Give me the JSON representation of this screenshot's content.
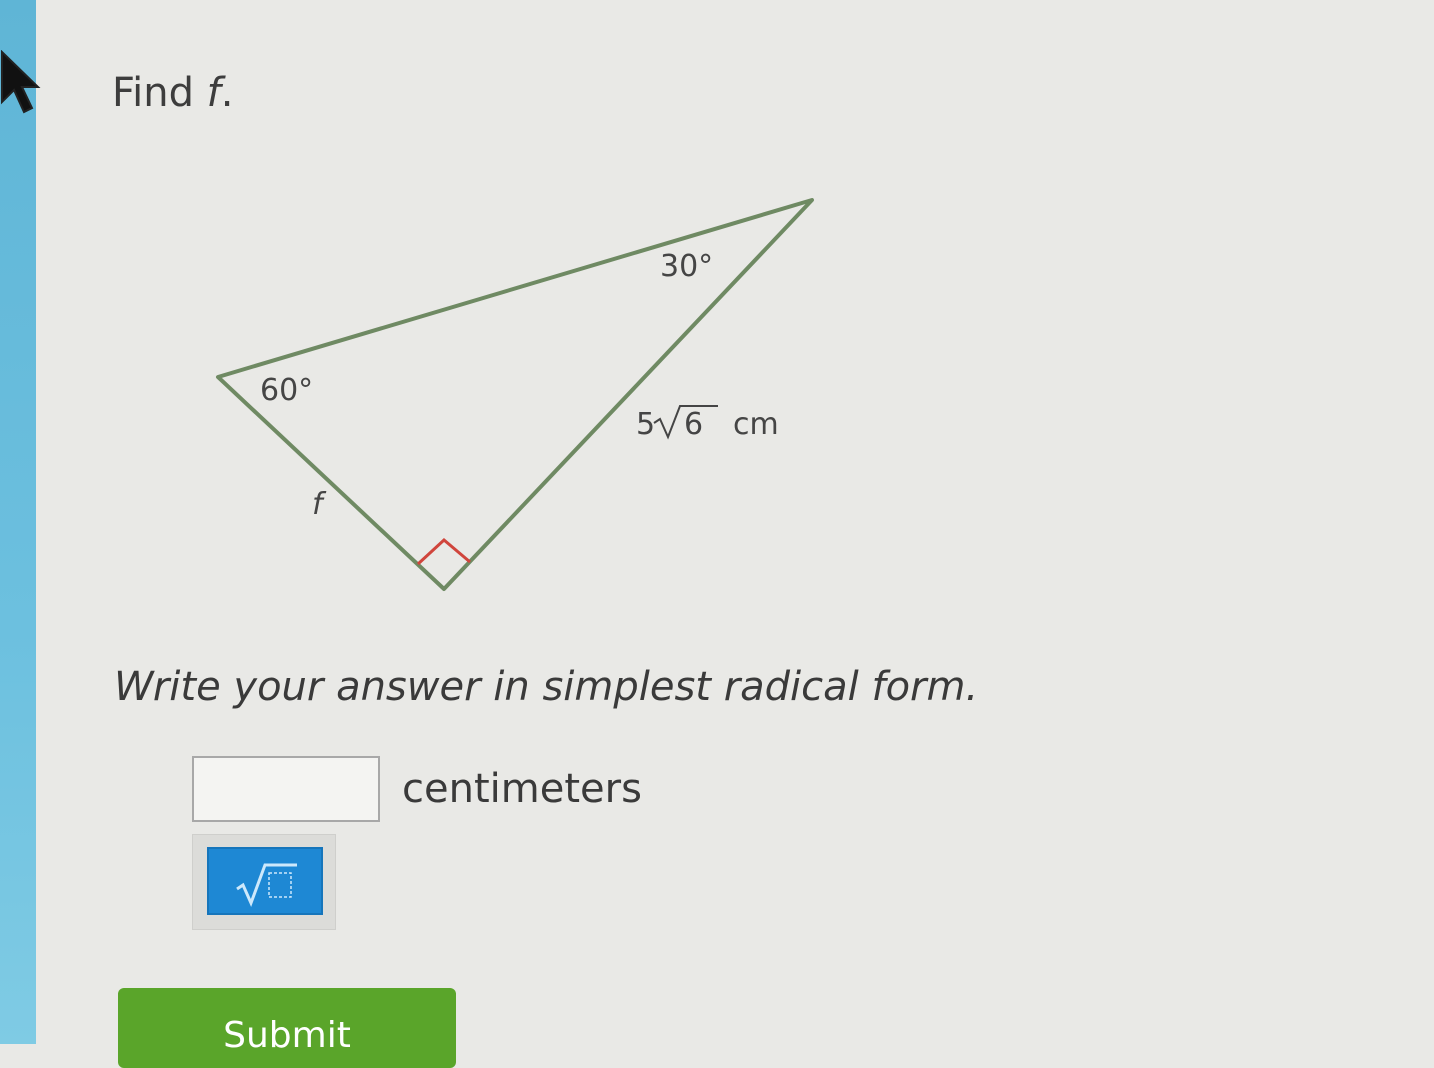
{
  "question": {
    "prefix": "Find ",
    "variable": "f",
    "suffix": "."
  },
  "figure": {
    "angle_top": "30°",
    "angle_left": "60°",
    "side_coefficient": "5",
    "side_radicand": "6",
    "side_unit": "cm",
    "side_variable": "f",
    "right_angle_color": "#d0453c",
    "line_color": "#6f8a63"
  },
  "instructions": "Write your answer in simplest radical form.",
  "answer": {
    "value": "",
    "unit": "centimeters"
  },
  "toolbar": {
    "sqrt_icon": "sqrt-icon"
  },
  "submit_label": "Submit"
}
